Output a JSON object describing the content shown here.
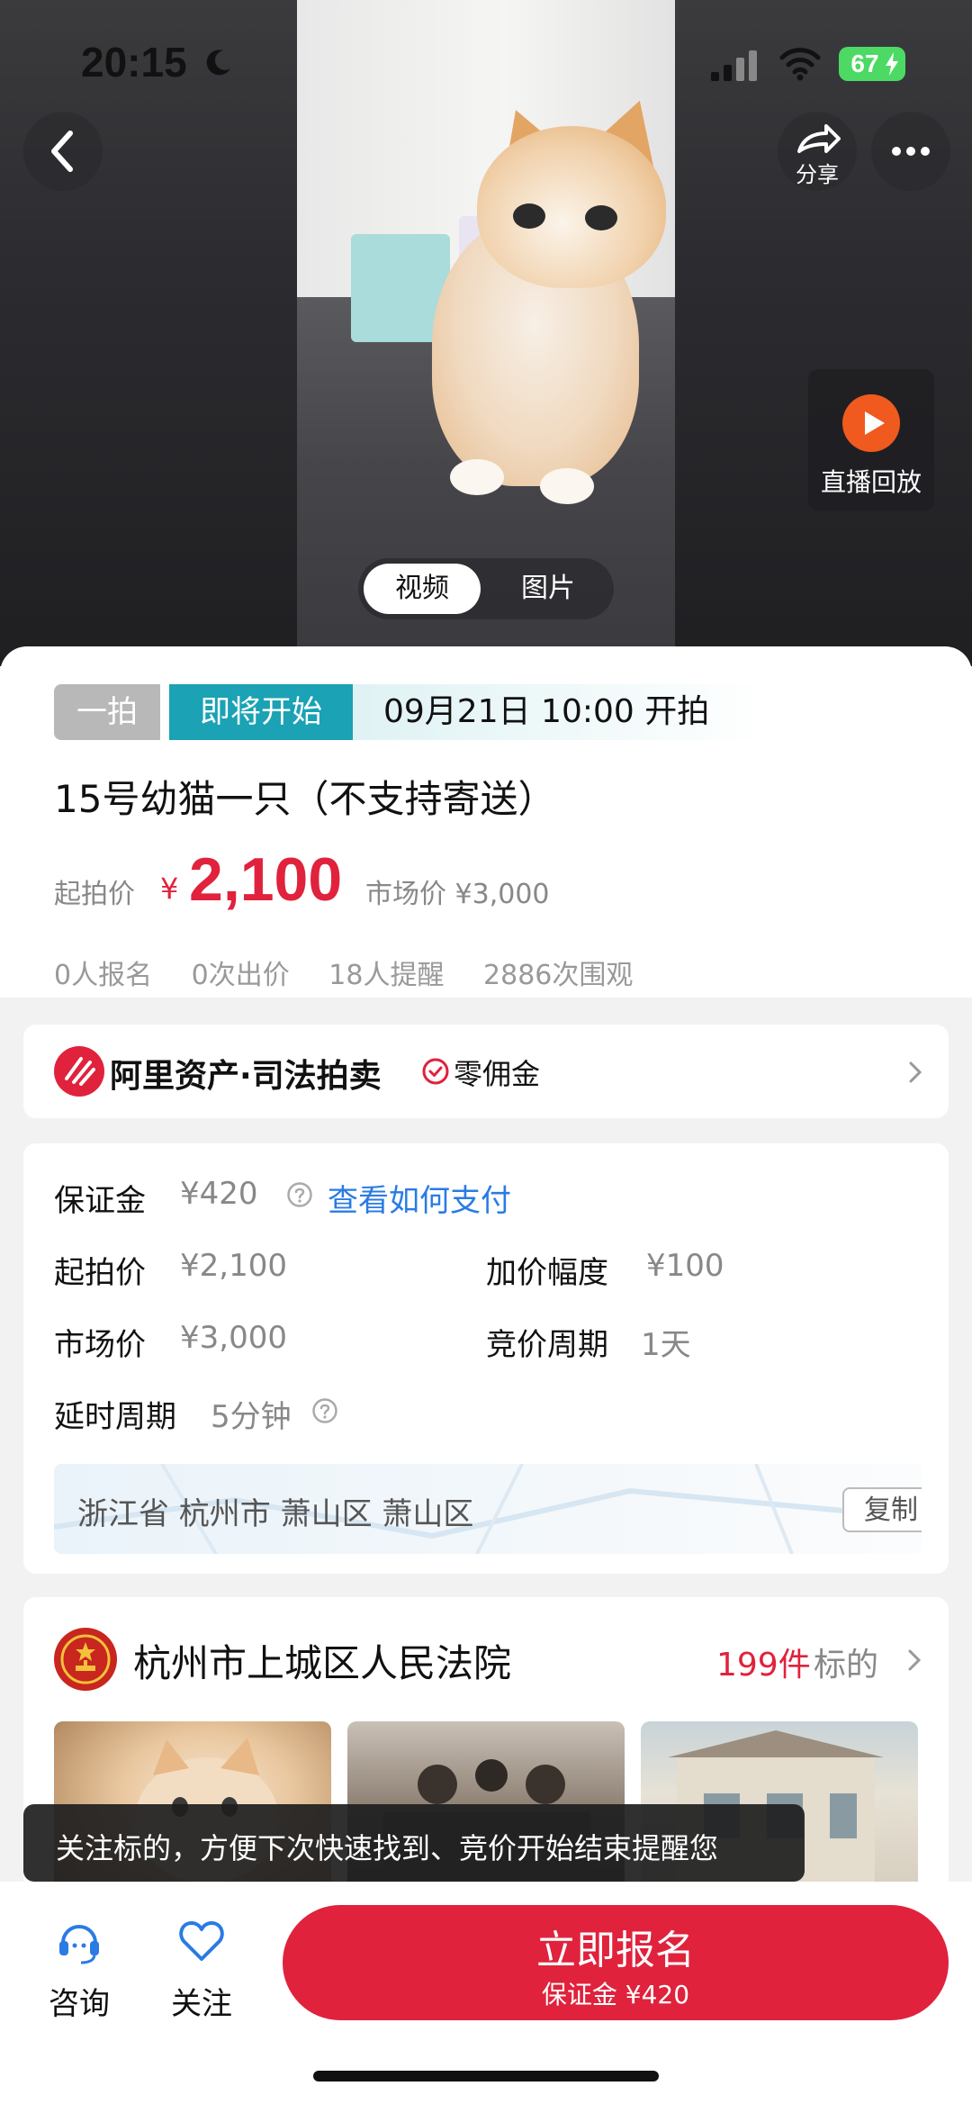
{
  "status_bar": {
    "time": "20:15",
    "battery": "67"
  },
  "media": {
    "share_label": "分享",
    "replay_label": "直播回放",
    "tabs": [
      {
        "label": "视频",
        "active": true
      },
      {
        "label": "图片",
        "active": false
      }
    ]
  },
  "auction": {
    "tag_round": "一拍",
    "tag_status": "即将开始",
    "start_time": "09月21日 10:00 开拍",
    "title": "15号幼猫一只（不支持寄送）",
    "start_price_label": "起拍价",
    "currency": "¥",
    "start_price": "2,100",
    "market_price_text": "市场价 ¥3,000",
    "stats": [
      "0人报名",
      "0次出价",
      "18人提醒",
      "2886次围观"
    ]
  },
  "platform": {
    "name": "阿里资产·司法拍卖",
    "commission": "零佣金"
  },
  "details": {
    "deposit_label": "保证金",
    "deposit_value": "¥420",
    "pay_link": "查看如何支付",
    "start_label": "起拍价",
    "start_value": "¥2,100",
    "increment_label": "加价幅度",
    "increment_value": "¥100",
    "market_label": "市场价",
    "market_value": "¥3,000",
    "cycle_label": "竞价周期",
    "cycle_value": "1天",
    "delay_label": "延时周期",
    "delay_value": "5分钟",
    "address": "浙江省 杭州市 萧山区 萧山区",
    "copy_label": "复制"
  },
  "court": {
    "name": "杭州市上城区人民法院",
    "count": "199件",
    "count_suffix": "标的"
  },
  "tooltip": "关注标的，方便下次快速找到、竞价开始结束提醒您",
  "bottom_bar": {
    "consult_label": "咨询",
    "follow_label": "关注",
    "signup_label": "立即报名",
    "signup_sub": "保证金 ¥420"
  },
  "colors": {
    "accent": "#e0223c",
    "teal": "#1ba2b4",
    "link": "#2a7be4"
  },
  "icons": [
    "back-icon",
    "share-icon",
    "more-icon",
    "play-icon",
    "moon-icon",
    "wifi-icon",
    "signal-icon",
    "check-circle-icon",
    "chevron-right-icon",
    "help-icon",
    "headset-icon",
    "heart-icon",
    "court-emblem-icon",
    "alibaba-asset-logo"
  ]
}
